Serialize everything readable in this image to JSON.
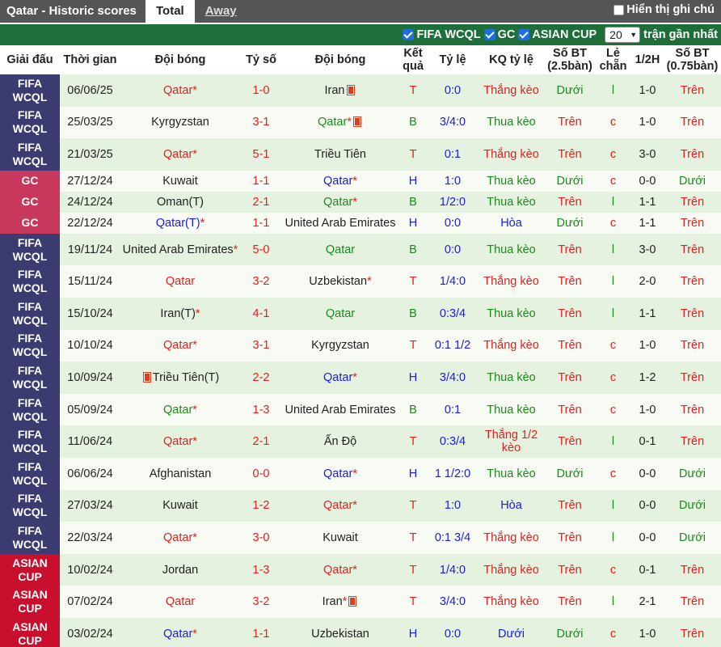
{
  "header": {
    "title": "Qatar - Historic scores",
    "tab_total": "Total",
    "tab_away": "Away",
    "show_hint": "Hiển thị ghi chú"
  },
  "filters": {
    "f1": "FIFA WCQL",
    "f2": "GC",
    "f3": "ASIAN CUP",
    "count": "20",
    "recent_label": "trận gần nhất"
  },
  "columns": [
    "Giải đấu",
    "Thời gian",
    "Đội bóng",
    "Tỷ số",
    "Đội bóng",
    "Kết quả",
    "Tỷ lệ",
    "KQ tỷ lệ",
    "Số BT (2.5bàn)",
    "Lẻ chẵn",
    "1/2H",
    "Số BT (0.75bàn)"
  ],
  "colors": {
    "FIFA WCQL": "#3b3b72",
    "GC": "#c8385c",
    "ASIAN CUP": "#c8102e"
  },
  "rows": [
    {
      "league": "FIFA WCQL",
      "date": "06/06/25",
      "home": "Qatar",
      "home_star": true,
      "home_color": "red",
      "home_card_before": false,
      "home_card_after": false,
      "score": "1-0",
      "away": "Iran",
      "away_star": false,
      "away_color": "dark",
      "away_card": true,
      "result": "T",
      "odds": "0:0",
      "odds_result": "Thắng kèo",
      "ou": "Dưới",
      "oe": "l",
      "half": "1-0",
      "ou2": "Trên"
    },
    {
      "league": "FIFA WCQL",
      "date": "25/03/25",
      "home": "Kyrgyzstan",
      "home_star": false,
      "home_color": "dark",
      "home_card_before": false,
      "home_card_after": false,
      "score": "3-1",
      "away": "Qatar",
      "away_star": true,
      "away_color": "green",
      "away_card": true,
      "result": "B",
      "odds": "3/4:0",
      "odds_result": "Thua kèo",
      "ou": "Trên",
      "oe": "c",
      "half": "1-0",
      "ou2": "Trên"
    },
    {
      "league": "FIFA WCQL",
      "date": "21/03/25",
      "home": "Qatar",
      "home_star": true,
      "home_color": "red",
      "home_card_before": false,
      "home_card_after": false,
      "score": "5-1",
      "away": "Triều Tiên",
      "away_star": false,
      "away_color": "dark",
      "away_card": false,
      "result": "T",
      "odds": "0:1",
      "odds_result": "Thắng kèo",
      "ou": "Trên",
      "oe": "c",
      "half": "3-0",
      "ou2": "Trên"
    },
    {
      "league": "GC",
      "date": "27/12/24",
      "home": "Kuwait",
      "home_star": false,
      "home_color": "dark",
      "home_card_before": false,
      "home_card_after": false,
      "score": "1-1",
      "away": "Qatar",
      "away_star": true,
      "away_color": "blue",
      "away_card": false,
      "result": "H",
      "odds": "1:0",
      "odds_result": "Thua kèo",
      "ou": "Dưới",
      "oe": "c",
      "half": "0-0",
      "ou2": "Dưới"
    },
    {
      "league": "GC",
      "date": "24/12/24",
      "home": "Oman(T)",
      "home_star": false,
      "home_color": "dark",
      "home_card_before": false,
      "home_card_after": false,
      "score": "2-1",
      "away": "Qatar",
      "away_star": true,
      "away_color": "green",
      "away_card": false,
      "result": "B",
      "odds": "1/2:0",
      "odds_result": "Thua kèo",
      "ou": "Trên",
      "oe": "l",
      "half": "1-1",
      "ou2": "Trên"
    },
    {
      "league": "GC",
      "date": "22/12/24",
      "home": "Qatar(T)",
      "home_star": true,
      "home_color": "blue",
      "home_card_before": false,
      "home_card_after": false,
      "score": "1-1",
      "away": "United Arab Emirates",
      "away_star": false,
      "away_color": "dark",
      "away_card": false,
      "result": "H",
      "odds": "0:0",
      "odds_result": "Hòa",
      "ou": "Dưới",
      "oe": "c",
      "half": "1-1",
      "ou2": "Trên"
    },
    {
      "league": "FIFA WCQL",
      "date": "19/11/24",
      "home": "United Arab Emirates",
      "home_star": true,
      "home_color": "dark",
      "home_card_before": false,
      "home_card_after": false,
      "score": "5-0",
      "away": "Qatar",
      "away_star": false,
      "away_color": "green",
      "away_card": false,
      "result": "B",
      "odds": "0:0",
      "odds_result": "Thua kèo",
      "ou": "Trên",
      "oe": "l",
      "half": "3-0",
      "ou2": "Trên"
    },
    {
      "league": "FIFA WCQL",
      "date": "15/11/24",
      "home": "Qatar",
      "home_star": false,
      "home_color": "red",
      "home_card_before": false,
      "home_card_after": false,
      "score": "3-2",
      "away": "Uzbekistan",
      "away_star": true,
      "away_color": "dark",
      "away_card": false,
      "result": "T",
      "odds": "1/4:0",
      "odds_result": "Thắng kèo",
      "ou": "Trên",
      "oe": "l",
      "half": "2-0",
      "ou2": "Trên"
    },
    {
      "league": "FIFA WCQL",
      "date": "15/10/24",
      "home": "Iran(T)",
      "home_star": true,
      "home_color": "dark",
      "home_card_before": false,
      "home_card_after": false,
      "score": "4-1",
      "away": "Qatar",
      "away_star": false,
      "away_color": "green",
      "away_card": false,
      "result": "B",
      "odds": "0:3/4",
      "odds_result": "Thua kèo",
      "ou": "Trên",
      "oe": "l",
      "half": "1-1",
      "ou2": "Trên"
    },
    {
      "league": "FIFA WCQL",
      "date": "10/10/24",
      "home": "Qatar",
      "home_star": true,
      "home_color": "red",
      "home_card_before": false,
      "home_card_after": false,
      "score": "3-1",
      "away": "Kyrgyzstan",
      "away_star": false,
      "away_color": "dark",
      "away_card": false,
      "result": "T",
      "odds": "0:1 1/2",
      "odds_result": "Thắng kèo",
      "ou": "Trên",
      "oe": "c",
      "half": "1-0",
      "ou2": "Trên"
    },
    {
      "league": "FIFA WCQL",
      "date": "10/09/24",
      "home": "Triều Tiên(T)",
      "home_star": false,
      "home_color": "dark",
      "home_card_before": true,
      "home_card_after": false,
      "score": "2-2",
      "away": "Qatar",
      "away_star": true,
      "away_color": "blue",
      "away_card": false,
      "result": "H",
      "odds": "3/4:0",
      "odds_result": "Thua kèo",
      "ou": "Trên",
      "oe": "c",
      "half": "1-2",
      "ou2": "Trên"
    },
    {
      "league": "FIFA WCQL",
      "date": "05/09/24",
      "home": "Qatar",
      "home_star": true,
      "home_color": "green",
      "home_card_before": false,
      "home_card_after": false,
      "score": "1-3",
      "away": "United Arab Emirates",
      "away_star": false,
      "away_color": "dark",
      "away_card": false,
      "result": "B",
      "odds": "0:1",
      "odds_result": "Thua kèo",
      "ou": "Trên",
      "oe": "c",
      "half": "1-0",
      "ou2": "Trên"
    },
    {
      "league": "FIFA WCQL",
      "date": "11/06/24",
      "home": "Qatar",
      "home_star": true,
      "home_color": "red",
      "home_card_before": false,
      "home_card_after": false,
      "score": "2-1",
      "away": "Ấn Độ",
      "away_star": false,
      "away_color": "dark",
      "away_card": false,
      "result": "T",
      "odds": "0:3/4",
      "odds_result": "Thắng 1/2 kèo",
      "ou": "Trên",
      "oe": "l",
      "half": "0-1",
      "ou2": "Trên"
    },
    {
      "league": "FIFA WCQL",
      "date": "06/06/24",
      "home": "Afghanistan",
      "home_star": false,
      "home_color": "dark",
      "home_card_before": false,
      "home_card_after": false,
      "score": "0-0",
      "away": "Qatar",
      "away_star": true,
      "away_color": "blue",
      "away_card": false,
      "result": "H",
      "odds": "1 1/2:0",
      "odds_result": "Thua kèo",
      "ou": "Dưới",
      "oe": "c",
      "half": "0-0",
      "ou2": "Dưới"
    },
    {
      "league": "FIFA WCQL",
      "date": "27/03/24",
      "home": "Kuwait",
      "home_star": false,
      "home_color": "dark",
      "home_card_before": false,
      "home_card_after": false,
      "score": "1-2",
      "away": "Qatar",
      "away_star": true,
      "away_color": "red",
      "away_card": false,
      "result": "T",
      "odds": "1:0",
      "odds_result": "Hòa",
      "ou": "Trên",
      "oe": "l",
      "half": "0-0",
      "ou2": "Dưới"
    },
    {
      "league": "FIFA WCQL",
      "date": "22/03/24",
      "home": "Qatar",
      "home_star": true,
      "home_color": "red",
      "home_card_before": false,
      "home_card_after": false,
      "score": "3-0",
      "away": "Kuwait",
      "away_star": false,
      "away_color": "dark",
      "away_card": false,
      "result": "T",
      "odds": "0:1 3/4",
      "odds_result": "Thắng kèo",
      "ou": "Trên",
      "oe": "l",
      "half": "0-0",
      "ou2": "Dưới"
    },
    {
      "league": "ASIAN CUP",
      "date": "10/02/24",
      "home": "Jordan",
      "home_star": false,
      "home_color": "dark",
      "home_card_before": false,
      "home_card_after": false,
      "score": "1-3",
      "away": "Qatar",
      "away_star": true,
      "away_color": "red",
      "away_card": false,
      "result": "T",
      "odds": "1/4:0",
      "odds_result": "Thắng kèo",
      "ou": "Trên",
      "oe": "c",
      "half": "0-1",
      "ou2": "Trên"
    },
    {
      "league": "ASIAN CUP",
      "date": "07/02/24",
      "home": "Qatar",
      "home_star": false,
      "home_color": "red",
      "home_card_before": false,
      "home_card_after": false,
      "score": "3-2",
      "away": "Iran",
      "away_star": true,
      "away_color": "dark",
      "away_card": true,
      "result": "T",
      "odds": "3/4:0",
      "odds_result": "Thắng kèo",
      "ou": "Trên",
      "oe": "l",
      "half": "2-1",
      "ou2": "Trên"
    },
    {
      "league": "ASIAN CUP",
      "date": "03/02/24",
      "home": "Qatar",
      "home_star": true,
      "home_color": "blue",
      "home_card_before": false,
      "home_card_after": false,
      "score": "1-1",
      "away": "Uzbekistan",
      "away_star": false,
      "away_color": "dark",
      "away_card": false,
      "result": "H",
      "odds": "0:0",
      "odds_result": "Dưới",
      "ou": "Dưới",
      "oe": "c",
      "half": "1-0",
      "ou2": "Trên"
    }
  ]
}
